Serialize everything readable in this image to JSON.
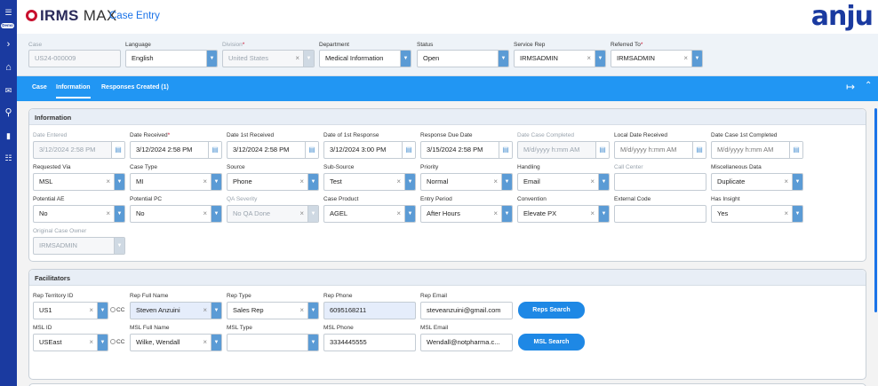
{
  "app": {
    "logo_main": "IRMS",
    "logo_max": "MAX",
    "page": "Case Entry",
    "brand": "anju",
    "demo_badge": "Demo"
  },
  "header_fields": [
    {
      "label": "Case",
      "value": "US24-000009",
      "disabled": true,
      "required": false
    },
    {
      "label": "Language",
      "value": "English"
    },
    {
      "label": "Division",
      "value": "United States",
      "disabled": true,
      "required": true
    },
    {
      "label": "Department",
      "value": "Medical Information"
    },
    {
      "label": "Status",
      "value": "Open"
    },
    {
      "label": "Service Rep",
      "value": "IRMSADMIN"
    },
    {
      "label": "Referred To",
      "value": "IRMSADMIN",
      "required": true
    }
  ],
  "tabs": [
    "Case",
    "Information",
    "Responses Created (1)"
  ],
  "info": {
    "title": "Information",
    "row1": [
      {
        "label": "Date Entered",
        "value": "3/12/2024 2:58 PM",
        "disabled": true
      },
      {
        "label": "Date Received",
        "value": "3/12/2024 2:58 PM",
        "required": true
      },
      {
        "label": "Date 1st Received",
        "value": "3/12/2024 2:58 PM"
      },
      {
        "label": "Date of 1st Response",
        "value": "3/12/2024 3:00 PM"
      },
      {
        "label": "Response Due Date",
        "value": "3/15/2024 2:58 PM"
      },
      {
        "label": "Date Case Completed",
        "value": "M/d/yyyy h:mm AM",
        "disabled": true,
        "placeholder": true
      },
      {
        "label": "Local Date Received",
        "value": "M/d/yyyy h:mm AM",
        "placeholder": true
      },
      {
        "label": "Date Case 1st Completed",
        "value": "M/d/yyyy h:mm AM",
        "placeholder": true
      }
    ],
    "row2": [
      {
        "label": "Requested Via",
        "value": "MSL"
      },
      {
        "label": "Case Type",
        "value": "MI"
      },
      {
        "label": "Source",
        "value": "Phone"
      },
      {
        "label": "Sub-Source",
        "value": "Test"
      },
      {
        "label": "Priority",
        "value": "Normal"
      },
      {
        "label": "Handling",
        "value": "Email"
      },
      {
        "label": "Call Center",
        "value": "",
        "text": true
      },
      {
        "label": "Miscellaneous Data",
        "value": "Duplicate"
      }
    ],
    "row3": [
      {
        "label": "Potential AE",
        "value": "No"
      },
      {
        "label": "Potential PC",
        "value": "No"
      },
      {
        "label": "QA Severity",
        "value": "No QA Done",
        "disabled": true
      },
      {
        "label": "Case Product",
        "value": "AGEL"
      },
      {
        "label": "Entry Period",
        "value": "After Hours"
      },
      {
        "label": "Convention",
        "value": "Elevate PX"
      },
      {
        "label": "External Code",
        "value": "",
        "text": true
      },
      {
        "label": "Has Insight",
        "value": "Yes"
      }
    ],
    "row4": [
      {
        "label": "Original Case Owner",
        "value": "IRMSADMIN",
        "disabled": true
      }
    ]
  },
  "facilitators": {
    "title": "Facilitators",
    "cc_label": "CC",
    "rep": {
      "territory_label": "Rep Territory ID",
      "territory": "US1",
      "name_label": "Rep Full Name",
      "name": "Steven Anzuini",
      "type_label": "Rep Type",
      "type": "Sales Rep",
      "phone_label": "Rep Phone",
      "phone": "6095168211",
      "email_label": "Rep Email",
      "email": "steveanzuini@gmail.com",
      "search": "Reps Search"
    },
    "msl": {
      "id_label": "MSL ID",
      "id": "USEast",
      "name_label": "MSL Full Name",
      "name": "Wilke, Wendall",
      "type_label": "MSL Type",
      "type": "",
      "phone_label": "MSL Phone",
      "phone": "3334445555",
      "email_label": "MSL Email",
      "email": "Wendall@notpharma.c...",
      "search": "MSL Search"
    }
  },
  "colors": {
    "nav": "#1a3aa0",
    "tabbar": "#2196f3",
    "accent": "#1e88e5",
    "logo_red": "#c8102e"
  }
}
